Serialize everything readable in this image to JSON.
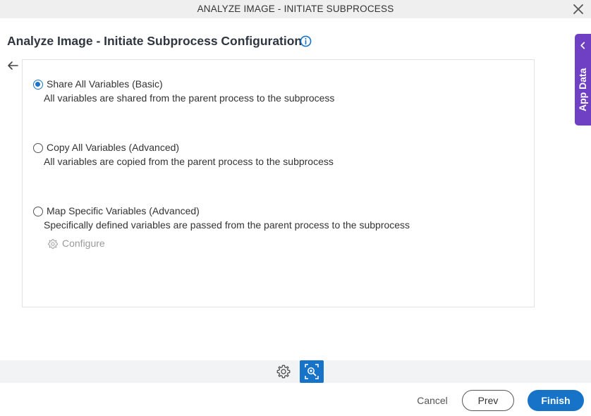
{
  "window": {
    "title": "ANALYZE IMAGE - INITIATE SUBPROCESS",
    "close_icon": "close-icon"
  },
  "header": {
    "page_title": "Analyze Image - Initiate Subprocess Configuration",
    "info_icon": "info-icon",
    "back_icon": "back-arrow-icon"
  },
  "options": [
    {
      "label": "Share All Variables (Basic)",
      "description": "All variables are shared from the parent process to the subprocess",
      "selected": true
    },
    {
      "label": "Copy All Variables (Advanced)",
      "description": "All variables are copied from the parent process to the subprocess",
      "selected": false
    },
    {
      "label": "Map Specific Variables (Advanced)",
      "description": "Specifically defined variables are passed from the parent process to the subprocess",
      "selected": false
    }
  ],
  "configure": {
    "label": "Configure",
    "icon": "gear-icon",
    "disabled": true
  },
  "side_panel": {
    "label": "App Data",
    "icon": "chevron-left-icon",
    "color": "#6f3fc4"
  },
  "toolbar": {
    "items": [
      {
        "icon": "gear-icon",
        "active": false
      },
      {
        "icon": "analyze-image-icon",
        "active": true
      }
    ],
    "active_color": "#1673c8"
  },
  "footer": {
    "cancel_label": "Cancel",
    "prev_label": "Prev",
    "finish_label": "Finish"
  }
}
